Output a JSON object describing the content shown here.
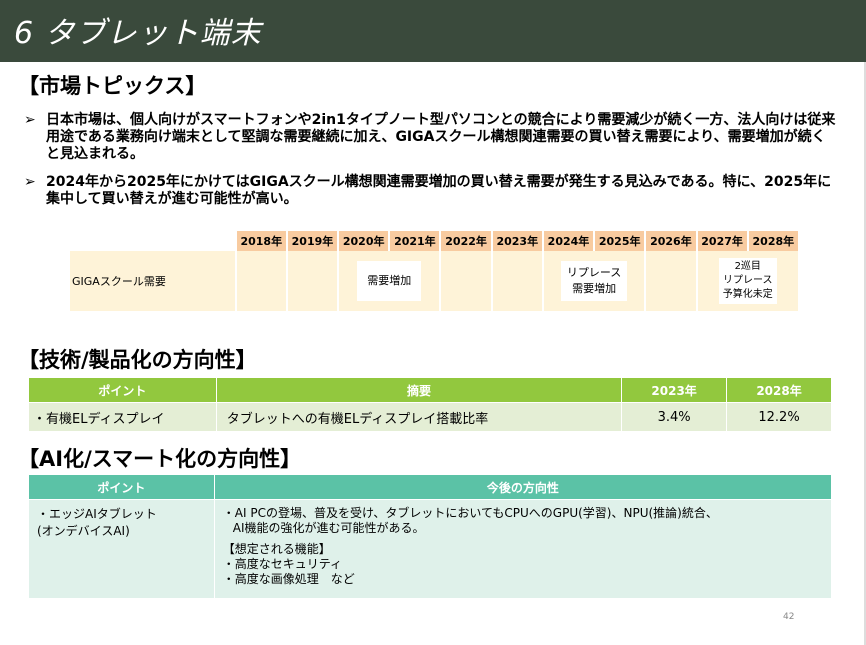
{
  "header": {
    "title": "6 タブレット端末"
  },
  "market": {
    "heading": "【市場トピックス】",
    "bullet_mark": "➢",
    "bullets": [
      "日本市場は、個人向けがスマートフォンや2in1タイプノート型パソコンとの競合により需要減少が続く一方、法人向けは従来用途である業務向け端末として堅調な需要継続に加え、GIGAスクール構想関連需要の買い替え需要により、需要増加が続くと見込まれる。",
      "2024年から2025年にかけてはGIGAスクール構想関連需要増加の買い替え需要が発生する見込みである。特に、2025年に集中して買い替えが進む可能性が高い。"
    ]
  },
  "timeline": {
    "years": [
      "2018年",
      "2019年",
      "2020年",
      "2021年",
      "2022年",
      "2023年",
      "2024年",
      "2025年",
      "2026年",
      "2027年",
      "2028年"
    ],
    "row_label": "GIGAスクール需要",
    "box1_line1": "需要増加",
    "box2_line1": "リプレース",
    "box2_line2": "需要増加",
    "box3_line1": "2巡目",
    "box3_line2": "リプレース",
    "box3_line3": "予算化未定"
  },
  "tech": {
    "heading": "【技術/製品化の方向性】",
    "headers": {
      "point": "ポイント",
      "summary": "摘要",
      "y2023": "2023年",
      "y2028": "2028年"
    },
    "row": {
      "point": "・有機ELディスプレイ",
      "summary": "タブレットへの有機ELディスプレイ搭載比率",
      "v2023": "3.4%",
      "v2028": "12.2%"
    }
  },
  "ai": {
    "heading": "【AI化/スマート化の方向性】",
    "headers": {
      "point": "ポイント",
      "direction": "今後の方向性"
    },
    "point_line1": "・エッジAIタブレット",
    "point_line2": "(オンデバイスAI)",
    "dir_line1": "・AI PCの登場、普及を受け、タブレットにおいてもCPUへのGPU(学習)、NPU(推論)統合、",
    "dir_line2": "AI機能の強化が進む可能性がある。",
    "feature_title": "【想定される機能】",
    "feature1": "・高度なセキュリティ",
    "feature2": "・高度な画像処理　など"
  },
  "footer": {
    "page": "42"
  }
}
